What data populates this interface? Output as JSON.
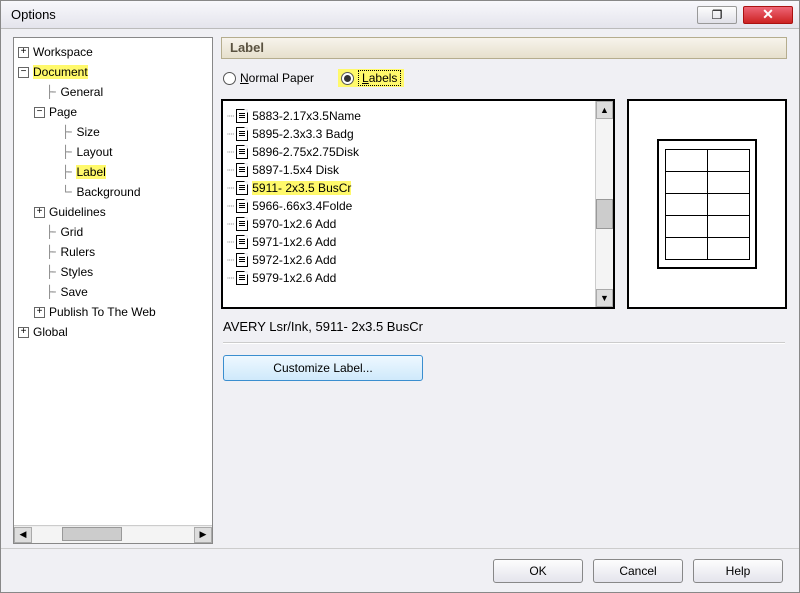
{
  "window": {
    "title": "Options"
  },
  "section": {
    "title": "Label"
  },
  "radio": {
    "normal": "Normal Paper",
    "labels": "Labels"
  },
  "tree": {
    "workspace": "Workspace",
    "document": "Document",
    "general": "General",
    "page": "Page",
    "size": "Size",
    "layout": "Layout",
    "label": "Label",
    "background": "Background",
    "guidelines": "Guidelines",
    "grid": "Grid",
    "rulers": "Rulers",
    "styles": "Styles",
    "save": "Save",
    "publish": "Publish To The Web",
    "global": "Global"
  },
  "list": {
    "items": [
      "5883-2.17x3.5Name",
      "5895-2.3x3.3 Badg",
      "5896-2.75x2.75Disk",
      "5897-1.5x4 Disk",
      "5911- 2x3.5 BusCr",
      "5966-.66x3.4Folde",
      "5970-1x2.6 Add",
      "5971-1x2.6 Add",
      "5972-1x2.6 Add",
      "5979-1x2.6 Add"
    ],
    "selected_index": 4
  },
  "status": "AVERY Lsr/Ink, 5911- 2x3.5 BusCr",
  "buttons": {
    "customize": "Customize Label...",
    "ok": "OK",
    "cancel": "Cancel",
    "help": "Help"
  }
}
